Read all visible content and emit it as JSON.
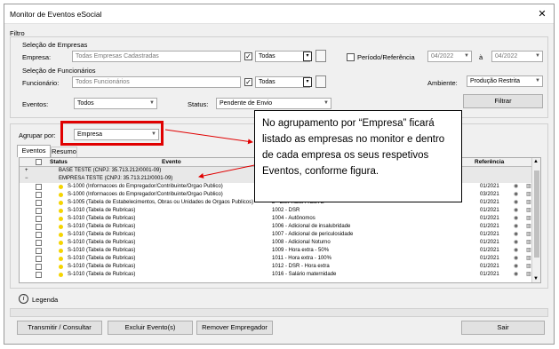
{
  "window": {
    "title": "Monitor de Eventos eSocial",
    "close": "✕"
  },
  "filter": {
    "group_label": "Filtro",
    "empresas_section": "Seleção de Empresas",
    "empresa_label": "Empresa:",
    "empresa_value": "Todas Empresas Cadastradas",
    "empresa_combo": "Todas",
    "periodo_label": "Período/Referência",
    "periodo_from": "04/2022",
    "periodo_sep": "à",
    "periodo_to": "04/2022",
    "funcionarios_section": "Seleção de Funcionários",
    "funcionario_label": "Funcionário:",
    "funcionario_value": "Todos Funcionários",
    "funcionario_combo": "Todas",
    "ambiente_label": "Ambiente:",
    "ambiente_value": "Produção Restrita",
    "eventos_label": "Eventos:",
    "eventos_value": "Todos",
    "status_label": "Status:",
    "status_value": "Pendente de Envio",
    "filtrar_button": "Filtrar"
  },
  "group": {
    "label": "Agrupar por:",
    "value": "Empresa"
  },
  "tabs": [
    "Eventos",
    "Resumo"
  ],
  "grid": {
    "columns": {
      "status": "Status",
      "evento": "Evento",
      "referencia": "Referência"
    },
    "groups": [
      {
        "label": "BASE TESTE (CNPJ: 35.713.212/0001-09)",
        "toggle": "+"
      },
      {
        "label": "EMPRESA TESTE (CNPJ: 35.713.212/0001-09)",
        "toggle": "−"
      }
    ],
    "rows": [
      {
        "evento": "S-1000 (Informacoes do Empregador/Contribuinte/Orgao Publico)",
        "desc": "",
        "ref": "01/2021"
      },
      {
        "evento": "S-1000 (Informacoes do Empregador/Contribuinte/Orgao Publico)",
        "desc": "",
        "ref": "03/2021"
      },
      {
        "evento": "S-1005 (Tabela de Estabelecimentos, Obras ou Unidades de Orgaos Publicos)",
        "desc": "2 - EMPRESA TESTE",
        "ref": "01/2021"
      },
      {
        "evento": "S-1010 (Tabela de Rubricas)",
        "desc": "1002 - DSR",
        "ref": "01/2021"
      },
      {
        "evento": "S-1010 (Tabela de Rubricas)",
        "desc": "1004 - Autônomos",
        "ref": "01/2021"
      },
      {
        "evento": "S-1010 (Tabela de Rubricas)",
        "desc": "1006 - Adicional de insalubridade",
        "ref": "01/2021"
      },
      {
        "evento": "S-1010 (Tabela de Rubricas)",
        "desc": "1007 - Adicional de periculosidade",
        "ref": "01/2021"
      },
      {
        "evento": "S-1010 (Tabela de Rubricas)",
        "desc": "1008 - Adicional Noturno",
        "ref": "01/2021"
      },
      {
        "evento": "S-1010 (Tabela de Rubricas)",
        "desc": "1009 - Hora extra - 50%",
        "ref": "01/2021"
      },
      {
        "evento": "S-1010 (Tabela de Rubricas)",
        "desc": "1011 - Hora extra - 100%",
        "ref": "01/2021"
      },
      {
        "evento": "S-1010 (Tabela de Rubricas)",
        "desc": "1012 - DSR - Hora extra",
        "ref": "01/2021"
      },
      {
        "evento": "S-1010 (Tabela de Rubricas)",
        "desc": "1016 - Salário maternidade",
        "ref": "01/2021"
      }
    ]
  },
  "legend_label": "Legenda",
  "buttons": {
    "transmitir": "Transmitir / Consultar",
    "excluir": "Excluir Evento(s)",
    "remover": "Remover Empregador",
    "sair": "Sair"
  },
  "callout": "No agrupamento por “Empresa” ficará listado as empresas no monitor e dentro de cada empresa os seus respetivos Eventos, conforme figura.",
  "colors": {
    "highlight": "#e00000",
    "status_pending": "#f5d400"
  }
}
